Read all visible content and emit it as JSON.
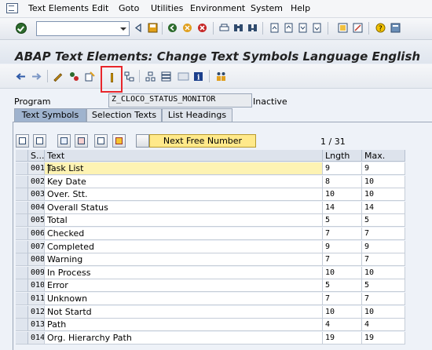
{
  "menu": [
    "Text Elements",
    "Edit",
    "Goto",
    "Utilities",
    "Environment",
    "System",
    "Help"
  ],
  "command_field": {
    "value": ""
  },
  "title": "ABAP Text Elements: Change Text Symbols Language English",
  "program": {
    "label": "Program",
    "value": "Z_CLOCO_STATUS_MONITOR",
    "status": "Inactive"
  },
  "tabs": [
    "Text Symbols",
    "Selection Texts",
    "List Headings"
  ],
  "next_free_number_label": "Next Free Number",
  "page_info": "1  /  31",
  "columns": {
    "sym": "S...",
    "text": "Text",
    "length": "Lngth",
    "max": "Max."
  },
  "rows": [
    {
      "sym": "001",
      "text": "Task List",
      "length": "9",
      "max": "9"
    },
    {
      "sym": "002",
      "text": "Key Date",
      "length": "8",
      "max": "10"
    },
    {
      "sym": "003",
      "text": "Over. Stt.",
      "length": "10",
      "max": "10"
    },
    {
      "sym": "004",
      "text": "Overall Status",
      "length": "14",
      "max": "14"
    },
    {
      "sym": "005",
      "text": "Total",
      "length": "5",
      "max": "5"
    },
    {
      "sym": "006",
      "text": "Checked",
      "length": "7",
      "max": "7"
    },
    {
      "sym": "007",
      "text": "Completed",
      "length": "9",
      "max": "9"
    },
    {
      "sym": "008",
      "text": "Warning",
      "length": "7",
      "max": "7"
    },
    {
      "sym": "009",
      "text": "In Process",
      "length": "10",
      "max": "10"
    },
    {
      "sym": "010",
      "text": "Error",
      "length": "5",
      "max": "5"
    },
    {
      "sym": "011",
      "text": "Unknown",
      "length": "7",
      "max": "7"
    },
    {
      "sym": "012",
      "text": "Not Startd",
      "length": "10",
      "max": "10"
    },
    {
      "sym": "013",
      "text": "Path",
      "length": "4",
      "max": "4"
    },
    {
      "sym": "014",
      "text": "Org. Hierarchy Path",
      "length": "19",
      "max": "19"
    }
  ],
  "colors": {
    "highlight_frame": "#e8262b",
    "active_tab": "#9fb3ce",
    "focus_cell": "#fdf3b3"
  }
}
